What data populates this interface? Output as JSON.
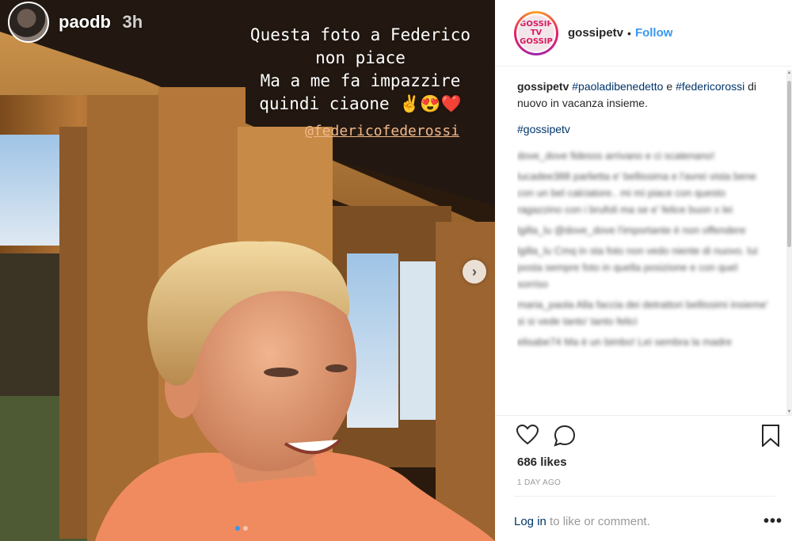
{
  "story": {
    "username": "paodb",
    "time": "3h",
    "caption_lines": [
      "Questa foto a Federico",
      "non piace",
      "Ma a me fa impazzire",
      "quindi ciaone ✌️😍❤️"
    ],
    "mention": "@federicofederossi",
    "next_arrow": "›"
  },
  "post": {
    "username": "gossipetv",
    "separator": "•",
    "follow_label": "Follow",
    "logo_text": [
      "GOSSIP",
      "TV",
      "GOSSIP",
      "TV"
    ],
    "caption": {
      "user": "gossipetv",
      "tag1": "#paoladibenedetto",
      "joiner": " e ",
      "tag2": "#federicorossi",
      "text": " di nuovo in vacanza insieme.",
      "tag3": "#gossipetv"
    },
    "blurred_comments": [
      "dove_dove fidesss arrivano e ci scatenano!",
      "lucadee388 parlietta e' bellissima e l'avrei vista bene con un bel calciatore.. mi mi piace con questo ragazzino con i brufoli ma se e' felice buon x lei",
      "lgilla_lu @dove_dove l'importante è non offendere",
      "lgilla_lu Cmq in sta foto non vedo niente di nuovo. lui posta sempre foto in quella posizione e con quel sorriso",
      "maria_paola Alla faccia dei detrattori bellissimi insieme' si si vede tanto' tanto felici",
      "elisabe74 Ma è un bimbo! Lei sembra la madre"
    ],
    "likes": "686 likes",
    "time_ago": "1 DAY AGO",
    "login_link": "Log in",
    "login_text": " to like or comment.",
    "more": "•••"
  },
  "colors": {
    "accent": "#3897f0",
    "link": "#003569",
    "muted": "#999999"
  }
}
